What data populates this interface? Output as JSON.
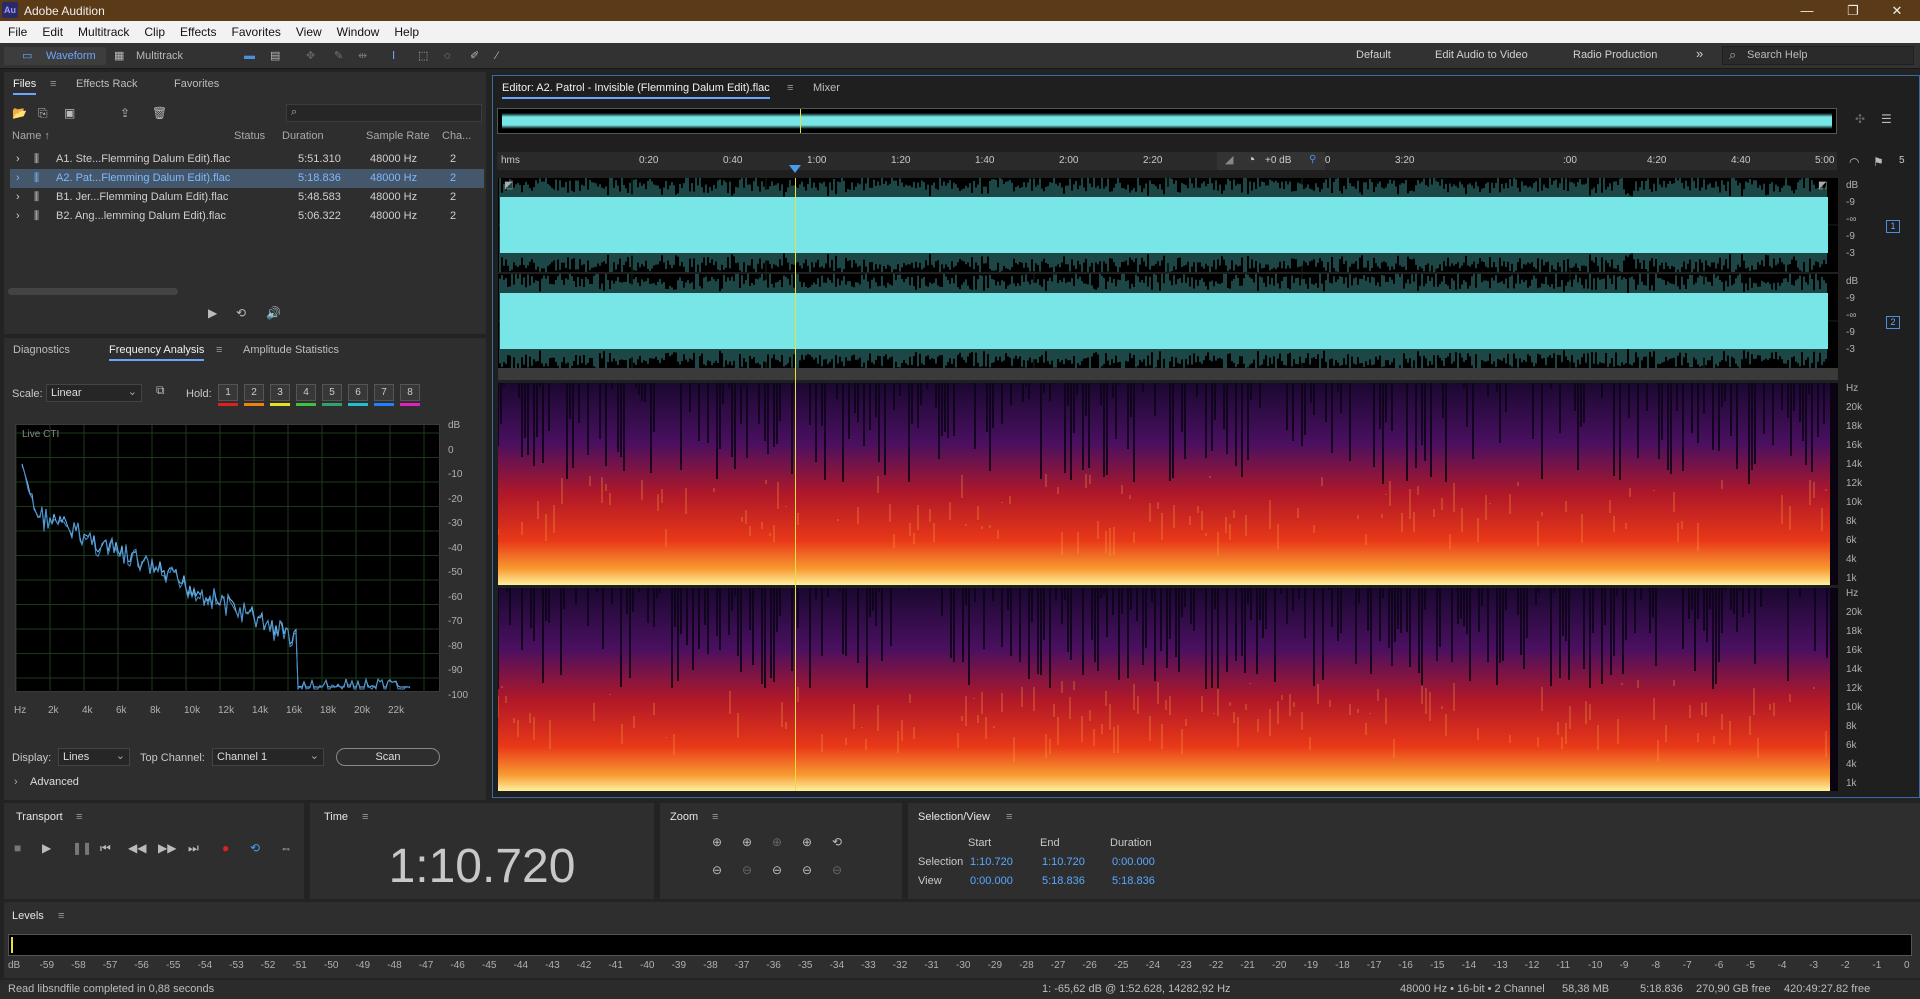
{
  "app": {
    "title": "Adobe Audition",
    "logo": "Au"
  },
  "menu": [
    "File",
    "Edit",
    "Multitrack",
    "Clip",
    "Effects",
    "Favorites",
    "View",
    "Window",
    "Help"
  ],
  "toolbar": {
    "waveform_label": "Waveform",
    "multitrack_label": "Multitrack"
  },
  "workspaces": {
    "items": [
      "Default",
      "Edit Audio to Video",
      "Radio Production"
    ],
    "more": "»",
    "search_placeholder": "Search Help"
  },
  "files_panel": {
    "tabs": [
      "Files",
      "Effects Rack",
      "Favorites"
    ],
    "columns": [
      "Name ↑",
      "Status",
      "Duration",
      "Sample Rate",
      "Cha..."
    ],
    "rows": [
      {
        "name": "A1. Ste...Flemming Dalum Edit).flac",
        "status": "",
        "duration": "5:51.310",
        "rate": "48000 Hz",
        "ch": "2"
      },
      {
        "name": "A2. Pat...Flemming Dalum Edit).flac",
        "status": "",
        "duration": "5:18.836",
        "rate": "48000 Hz",
        "ch": "2"
      },
      {
        "name": "B1. Jer...Flemming Dalum Edit).flac",
        "status": "",
        "duration": "5:48.583",
        "rate": "48000 Hz",
        "ch": "2"
      },
      {
        "name": "B2. Ang...lemming Dalum Edit).flac",
        "status": "",
        "duration": "5:06.322",
        "rate": "48000 Hz",
        "ch": "2"
      }
    ],
    "selected_index": 1
  },
  "analysis_panel": {
    "tabs": [
      "Diagnostics",
      "Frequency Analysis",
      "Amplitude Statistics"
    ],
    "scale_label": "Scale:",
    "scale_value": "Linear",
    "hold_label": "Hold:",
    "hold_slots": [
      {
        "n": "1",
        "color": "#e02020"
      },
      {
        "n": "2",
        "color": "#f08010"
      },
      {
        "n": "3",
        "color": "#e8e020"
      },
      {
        "n": "4",
        "color": "#40c040"
      },
      {
        "n": "5",
        "color": "#30a070"
      },
      {
        "n": "6",
        "color": "#20c0d0"
      },
      {
        "n": "7",
        "color": "#2080ff"
      },
      {
        "n": "8",
        "color": "#e020c0"
      }
    ],
    "graph_label": "Live CTI",
    "db_ticks": [
      "dB",
      "0",
      "-10",
      "-20",
      "-30",
      "-40",
      "-50",
      "-60",
      "-70",
      "-80",
      "-90",
      "-100"
    ],
    "hz_ticks": [
      "Hz",
      "2k",
      "4k",
      "6k",
      "8k",
      "10k",
      "12k",
      "14k",
      "16k",
      "18k",
      "20k",
      "22k"
    ],
    "display_label": "Display:",
    "display_value": "Lines",
    "top_channel_label": "Top Channel:",
    "top_channel_value": "Channel 1",
    "scan_label": "Scan",
    "advanced_label": "Advanced"
  },
  "editor": {
    "tab": "Editor: A2. Patrol - Invisible (Flemming Dalum Edit).flac",
    "mixer_tab": "Mixer",
    "ruler": [
      "hms",
      "0:20",
      "0:40",
      "1:00",
      "1:20",
      "1:40",
      "2:00",
      "2:20",
      "2:40",
      "3:00",
      "3:20",
      "",
      ":00",
      "4:20",
      "4:40",
      "5:00",
      "5"
    ],
    "gain": "+0 dB",
    "wave_db_ticks": [
      "dB",
      "-9",
      "-∞",
      "-9",
      "-3"
    ],
    "channel_numbers": [
      "1",
      "2"
    ],
    "spec_ticks": [
      "Hz",
      "20k",
      "18k",
      "16k",
      "14k",
      "12k",
      "10k",
      "8k",
      "6k",
      "4k",
      "1k"
    ],
    "wave_color": "#78e6e6"
  },
  "transport": {
    "title": "Transport"
  },
  "time": {
    "title": "Time",
    "value": "1:10.720"
  },
  "zoom": {
    "title": "Zoom"
  },
  "selection_view": {
    "title": "Selection/View",
    "headers": [
      "Start",
      "End",
      "Duration"
    ],
    "rows": [
      {
        "label": "Selection",
        "start": "1:10.720",
        "end": "1:10.720",
        "duration": "0:00.000"
      },
      {
        "label": "View",
        "start": "0:00.000",
        "end": "5:18.836",
        "duration": "5:18.836"
      }
    ]
  },
  "levels": {
    "title": "Levels",
    "ticks": [
      "dB",
      "-59",
      "-58",
      "-57",
      "-56",
      "-55",
      "-54",
      "-53",
      "-52",
      "-51",
      "-50",
      "-49",
      "-48",
      "-47",
      "-46",
      "-45",
      "-44",
      "-43",
      "-42",
      "-41",
      "-40",
      "-39",
      "-38",
      "-37",
      "-36",
      "-35",
      "-34",
      "-33",
      "-32",
      "-31",
      "-30",
      "-29",
      "-28",
      "-27",
      "-26",
      "-25",
      "-24",
      "-23",
      "-22",
      "-21",
      "-20",
      "-19",
      "-18",
      "-17",
      "-16",
      "-15",
      "-14",
      "-13",
      "-12",
      "-11",
      "-10",
      "-9",
      "-8",
      "-7",
      "-6",
      "-5",
      "-4",
      "-3",
      "-2",
      "-1",
      "0"
    ]
  },
  "status": {
    "left": "Read libsndfile completed in 0,88 seconds",
    "cursor": "1: -65,62 dB @ 1:52.628, 14282,92 Hz",
    "format": "48000 Hz • 16-bit • 2 Channel",
    "size": "58,38 MB",
    "duration": "5:18.836",
    "free": "270,90 GB free",
    "free_time": "420:49:27.82 free"
  }
}
